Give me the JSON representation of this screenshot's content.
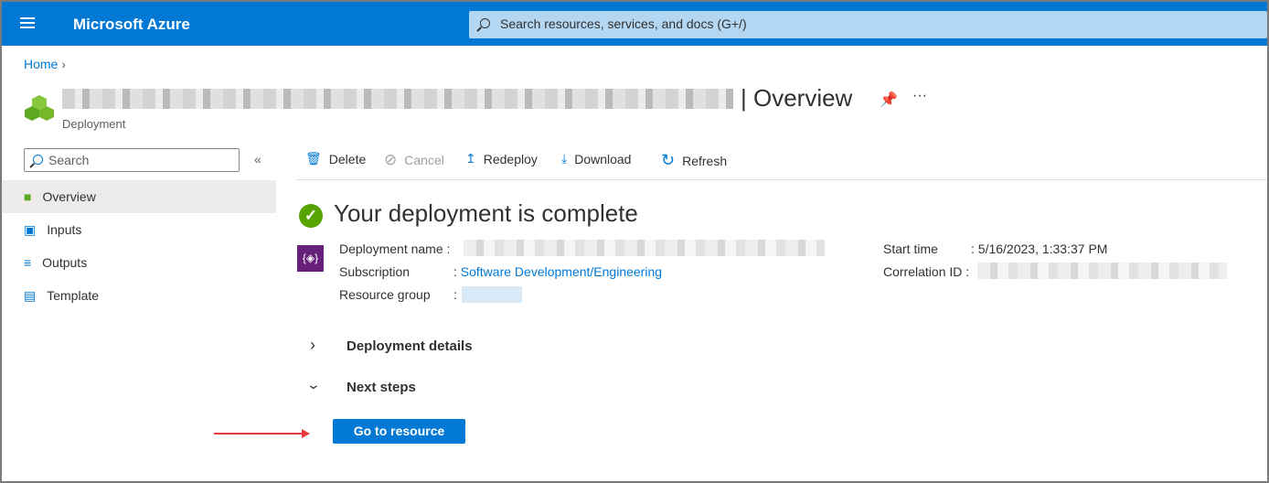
{
  "header": {
    "brand": "Microsoft Azure",
    "search_placeholder": "Search resources, services, and docs (G+/)"
  },
  "breadcrumb": {
    "home": "Home"
  },
  "page": {
    "title_suffix": "| Overview",
    "subtitle": "Deployment"
  },
  "sidebar": {
    "search_placeholder": "Search",
    "items": [
      {
        "label": "Overview"
      },
      {
        "label": "Inputs"
      },
      {
        "label": "Outputs"
      },
      {
        "label": "Template"
      }
    ]
  },
  "toolbar": {
    "delete": "Delete",
    "cancel": "Cancel",
    "redeploy": "Redeploy",
    "download": "Download",
    "refresh": "Refresh"
  },
  "status": {
    "heading": "Your deployment is complete"
  },
  "details": {
    "deployment_name_label": "Deployment name",
    "subscription_label": "Subscription",
    "subscription_value": "Software Development/Engineering",
    "resource_group_label": "Resource group",
    "start_time_label": "Start time",
    "start_time_value": "5/16/2023, 1:33:37 PM",
    "correlation_label": "Correlation ID"
  },
  "sections": {
    "deployment_details": "Deployment details",
    "next_steps": "Next steps"
  },
  "actions": {
    "go_to_resource": "Go to resource"
  }
}
